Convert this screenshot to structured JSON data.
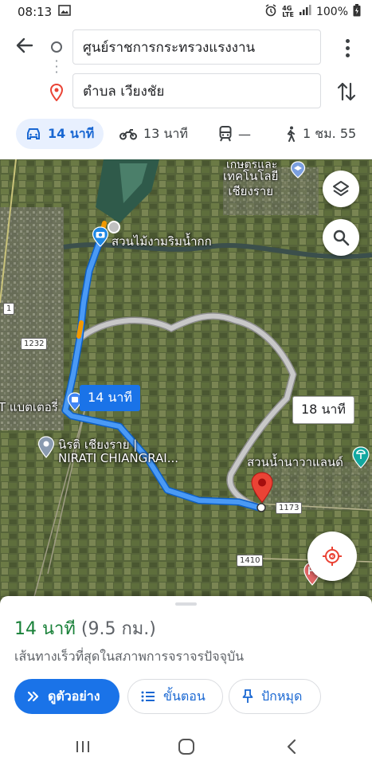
{
  "status_bar": {
    "time": "08:13",
    "battery": "100%",
    "network": "4G",
    "network_sub": "LTE"
  },
  "header": {
    "origin": "ศูนย์ราชการกระทรวงแรงงาน",
    "destination": "ตำบล เวียงชัย"
  },
  "modes": [
    {
      "name": "drive",
      "label": "14 นาที",
      "icon": "car-icon",
      "active": true
    },
    {
      "name": "motorcycle",
      "label": "13 นาที",
      "icon": "motorcycle-icon",
      "active": false
    },
    {
      "name": "transit",
      "label": "—",
      "icon": "train-icon",
      "active": false
    },
    {
      "name": "walk",
      "label": "1 ชม. 55",
      "icon": "walk-icon",
      "active": false
    }
  ],
  "map": {
    "labels": {
      "top": "เทคโนโลยี\nเชียงราย",
      "top_partial": "เกษตรและ",
      "park": "สวนไม้งามริมน้ำกก",
      "battery_shop": "T แบตเตอรี่",
      "nirati_th": "นิรติ เชียงราย |",
      "nirati_en": "NIRATI CHIANGRAI...",
      "waterpark": "สวนน้ำนาวาแลนด์"
    },
    "road_shields": [
      "1",
      "1232",
      "1173",
      "1410"
    ],
    "route_primary_time": "14 นาที",
    "route_alt_time": "18 นาที"
  },
  "sheet": {
    "duration": "14 นาที",
    "distance": "(9.5 กม.)",
    "description": "เส้นทางเร็วที่สุดในสภาพการจราจรปัจจุบัน",
    "preview_label": "ดูตัวอย่าง",
    "steps_label": "ขั้นตอน",
    "pin_label": "ปักหมุด"
  },
  "colors": {
    "accent": "#1a73e8",
    "duration_green": "#188038",
    "route_alt": "#bdbdbd",
    "destination_pin": "#ea4335"
  }
}
